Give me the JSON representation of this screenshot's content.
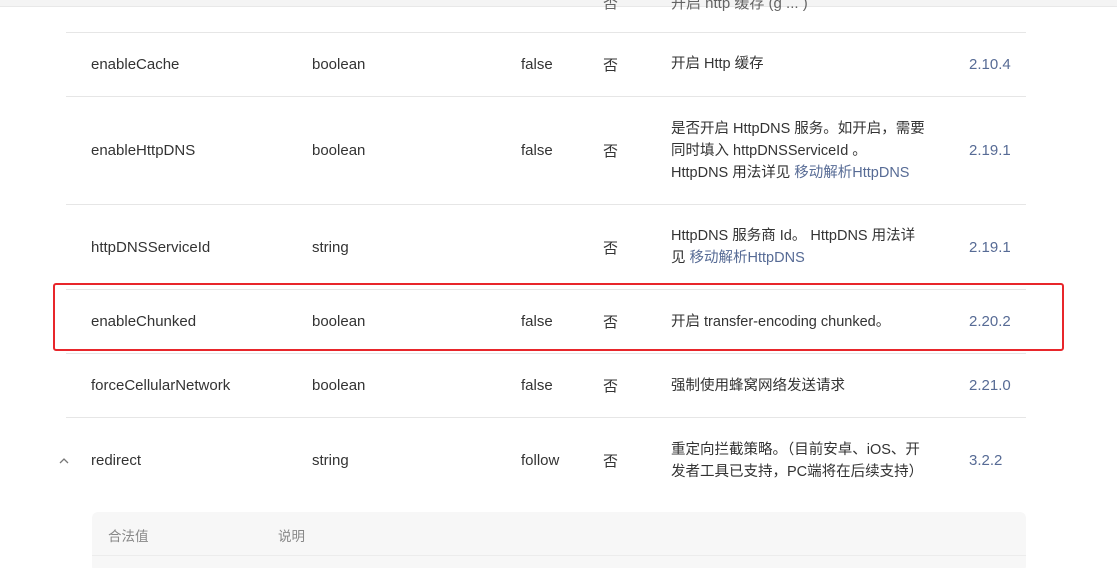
{
  "cutoff_row": {
    "required": "否",
    "desc": "开启 http 缓存 (g ... )"
  },
  "rows": [
    {
      "name": "enableCache",
      "type": "boolean",
      "default": "false",
      "required": "否",
      "desc": [
        "开启 Http 缓存"
      ],
      "link": "",
      "version": "2.10.4"
    },
    {
      "name": "enableHttpDNS",
      "type": "boolean",
      "default": "false",
      "required": "否",
      "desc": [
        "是否开启 HttpDNS 服务。如开启，需要",
        "同时填入 httpDNSServiceId 。",
        "HttpDNS 用法详见 "
      ],
      "link": "移动解析HttpDNS",
      "version": "2.19.1"
    },
    {
      "name": "httpDNSServiceId",
      "type": "string",
      "default": "",
      "required": "否",
      "desc": [
        "HttpDNS 服务商 Id。 HttpDNS 用法详",
        "见 "
      ],
      "link": "移动解析HttpDNS",
      "version": "2.19.1"
    },
    {
      "name": "enableChunked",
      "type": "boolean",
      "default": "false",
      "required": "否",
      "desc": [
        "开启 transfer-encoding chunked。"
      ],
      "link": "",
      "version": "2.20.2"
    },
    {
      "name": "forceCellularNetwork",
      "type": "boolean",
      "default": "false",
      "required": "否",
      "desc": [
        "强制使用蜂窝网络发送请求"
      ],
      "link": "",
      "version": "2.21.0"
    },
    {
      "name": "redirect",
      "type": "string",
      "default": "follow",
      "required": "否",
      "desc": [
        "重定向拦截策略。（目前安卓、iOS、开",
        "发者工具已支持，PC端将在后续支持）"
      ],
      "link": "",
      "version": "3.2.2",
      "expanded_icon": "chevron-up-icon"
    }
  ],
  "subtable": {
    "col_value": "合法值",
    "col_desc": "说明"
  },
  "colors": {
    "link": "#576b95",
    "highlight_border": "#e8262b",
    "divider": "#e6e6e6"
  }
}
